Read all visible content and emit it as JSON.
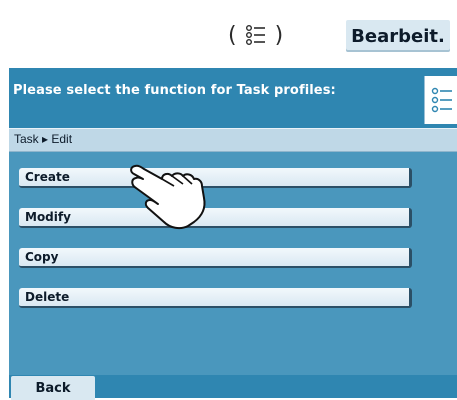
{
  "top": {
    "list_view_label_left": "(",
    "list_view_label_right": ")",
    "edit_button_label": "Bearbeit."
  },
  "header": {
    "title": "Please select the function for Task profiles:"
  },
  "breadcrumb": {
    "text": "Task ▸ Edit"
  },
  "functions": [
    {
      "label": "Create"
    },
    {
      "label": "Modify"
    },
    {
      "label": "Copy"
    },
    {
      "label": "Delete"
    }
  ],
  "footer": {
    "back_label": "Back"
  },
  "icons": {
    "list": "list-icon",
    "hand": "hand-pointer-icon"
  },
  "colors": {
    "screen_bg": "#4a97bd",
    "header_bg": "#2f86b1",
    "button_bg": "#d9e8f1"
  }
}
